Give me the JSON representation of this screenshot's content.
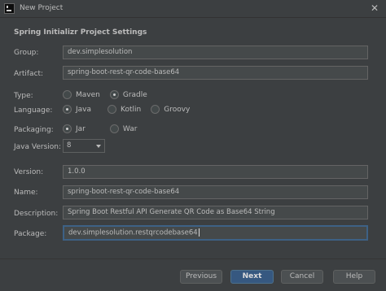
{
  "window": {
    "title": "New Project"
  },
  "section_title": "Spring Initializr Project Settings",
  "fields": {
    "group": {
      "label": "Group:",
      "value": "dev.simplesolution"
    },
    "artifact": {
      "label": "Artifact:",
      "value": "spring-boot-rest-qr-code-base64"
    },
    "version": {
      "label": "Version:",
      "value": "1.0.0"
    },
    "name": {
      "label": "Name:",
      "value": "spring-boot-rest-qr-code-base64"
    },
    "description": {
      "label": "Description:",
      "value": "Spring Boot Restful API Generate QR Code as Base64 String"
    },
    "package": {
      "label": "Package:",
      "value": "dev.simplesolution.restqrcodebase64"
    }
  },
  "type": {
    "label": "Type:",
    "options": [
      "Maven",
      "Gradle"
    ],
    "selected": "Gradle"
  },
  "language": {
    "label": "Language:",
    "options": [
      "Java",
      "Kotlin",
      "Groovy"
    ],
    "selected": "Java"
  },
  "packaging": {
    "label": "Packaging:",
    "options": [
      "Jar",
      "War"
    ],
    "selected": "Jar"
  },
  "java_version": {
    "label": "Java Version:",
    "value": "8"
  },
  "buttons": {
    "previous": "Previous",
    "next": "Next",
    "cancel": "Cancel",
    "help": "Help"
  }
}
